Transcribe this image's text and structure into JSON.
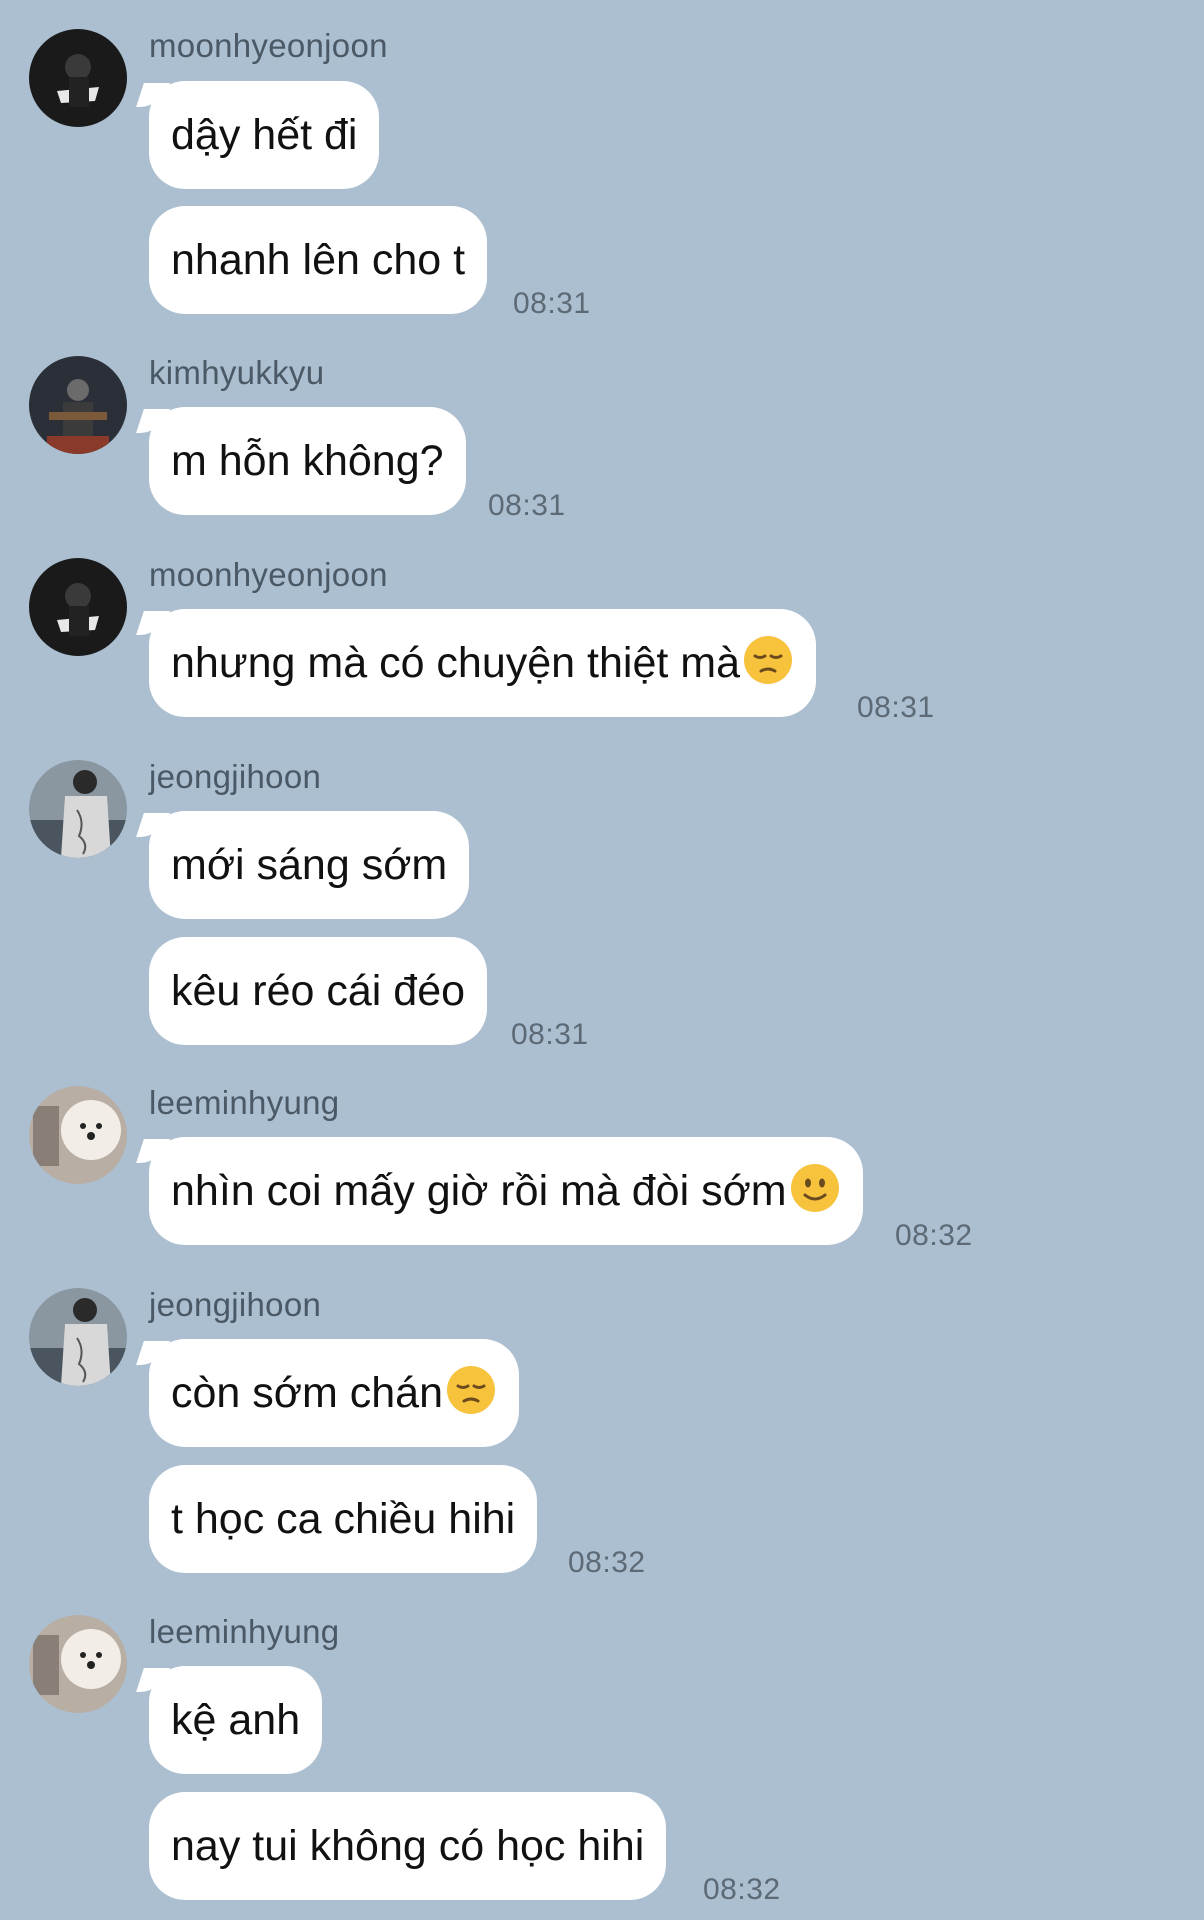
{
  "messages": [
    {
      "sender": "moonhyeonjoon",
      "lines": [
        "dậy hết đi",
        "nhanh lên cho t"
      ],
      "time": "08:31"
    },
    {
      "sender": "kimhyukkyu",
      "lines": [
        "m hỗn không?"
      ],
      "time": "08:31"
    },
    {
      "sender": "moonhyeonjoon",
      "lines": [
        "nhưng mà có chuyện thiệt mà"
      ],
      "emoji": "pensive-face-icon",
      "time": "08:31"
    },
    {
      "sender": "jeongjihoon",
      "lines": [
        "mới sáng sớm",
        "kêu réo cái đéo"
      ],
      "time": "08:31"
    },
    {
      "sender": "leeminhyung",
      "lines": [
        "nhìn coi mấy giờ rồi mà đòi sớm"
      ],
      "emoji": "slightly-smiling-face-icon",
      "time": "08:32"
    },
    {
      "sender": "jeongjihoon",
      "lines": [
        "còn sớm chán",
        "t học ca chiều hihi"
      ],
      "emoji": "pensive-face-icon",
      "time": "08:32"
    },
    {
      "sender": "leeminhyung",
      "lines": [
        "kệ anh",
        "nay tui không có học hihi"
      ],
      "time": "08:32"
    }
  ],
  "colors": {
    "background": "#abbfd0",
    "bubble": "#ffffff",
    "time": "#5d6a76",
    "sender": "#4b5865"
  }
}
